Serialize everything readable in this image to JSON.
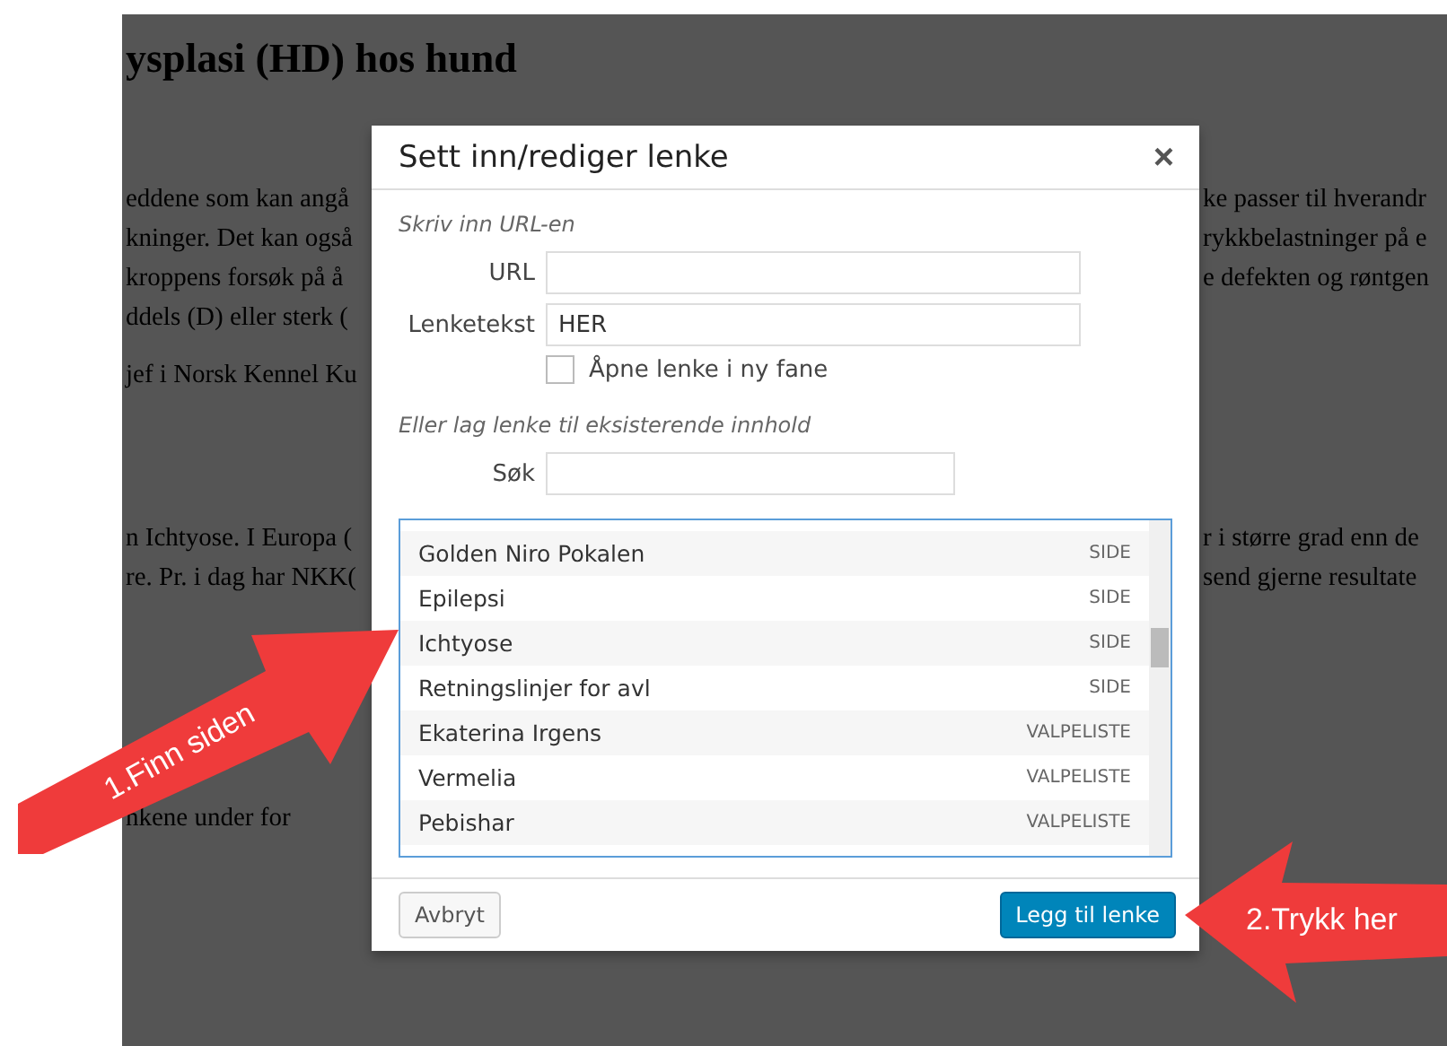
{
  "background": {
    "heading": "ysplasi (HD) hos hund",
    "paragraphs": [
      {
        "left": [
          "eddene som kan angå",
          "kninger. Det kan også",
          "kroppens forsøk på å",
          "ddels (D) eller sterk ("
        ],
        "right": [
          "ke passer til hverandr",
          "rykkbelastninger på e",
          "e defekten og røntgen"
        ]
      },
      {
        "left": [
          "jef i Norsk Kennel Ku"
        ]
      },
      {
        "left": [
          "n Ichtyose.  I Europa (",
          "re. Pr. i dag har NKK("
        ],
        "right": [
          "r i større grad enn de",
          "send gjerne resultate"
        ]
      },
      {
        "left": [
          "nkene under for"
        ]
      }
    ]
  },
  "dialog": {
    "title": "Sett inn/rediger lenke",
    "close": "×",
    "url_section": "Skriv inn URL-en",
    "url": {
      "label": "URL"
    },
    "link_text": {
      "label": "Lenketekst",
      "value": "HER"
    },
    "new_tab": {
      "label": "Åpne lenke i ny fane",
      "checked": false
    },
    "existing_section": "Eller lag lenke til eksisterende innhold",
    "search": {
      "label": "Søk"
    },
    "results": [
      {
        "title": "Golden Niro Pokalen",
        "type": "SIDE"
      },
      {
        "title": "Epilepsi",
        "type": "SIDE"
      },
      {
        "title": "Ichtyose",
        "type": "SIDE"
      },
      {
        "title": "Retningslinjer for avl",
        "type": "SIDE"
      },
      {
        "title": "Ekaterina Irgens",
        "type": "VALPELISTE"
      },
      {
        "title": "Vermelia",
        "type": "VALPELISTE"
      },
      {
        "title": "Pebishar",
        "type": "VALPELISTE"
      }
    ],
    "cancel": "Avbryt",
    "submit": "Legg til lenke"
  },
  "callouts": [
    {
      "kind": "up-right",
      "text": "1.Finn siden"
    },
    {
      "kind": "left",
      "text": "2.Trykk her"
    }
  ]
}
